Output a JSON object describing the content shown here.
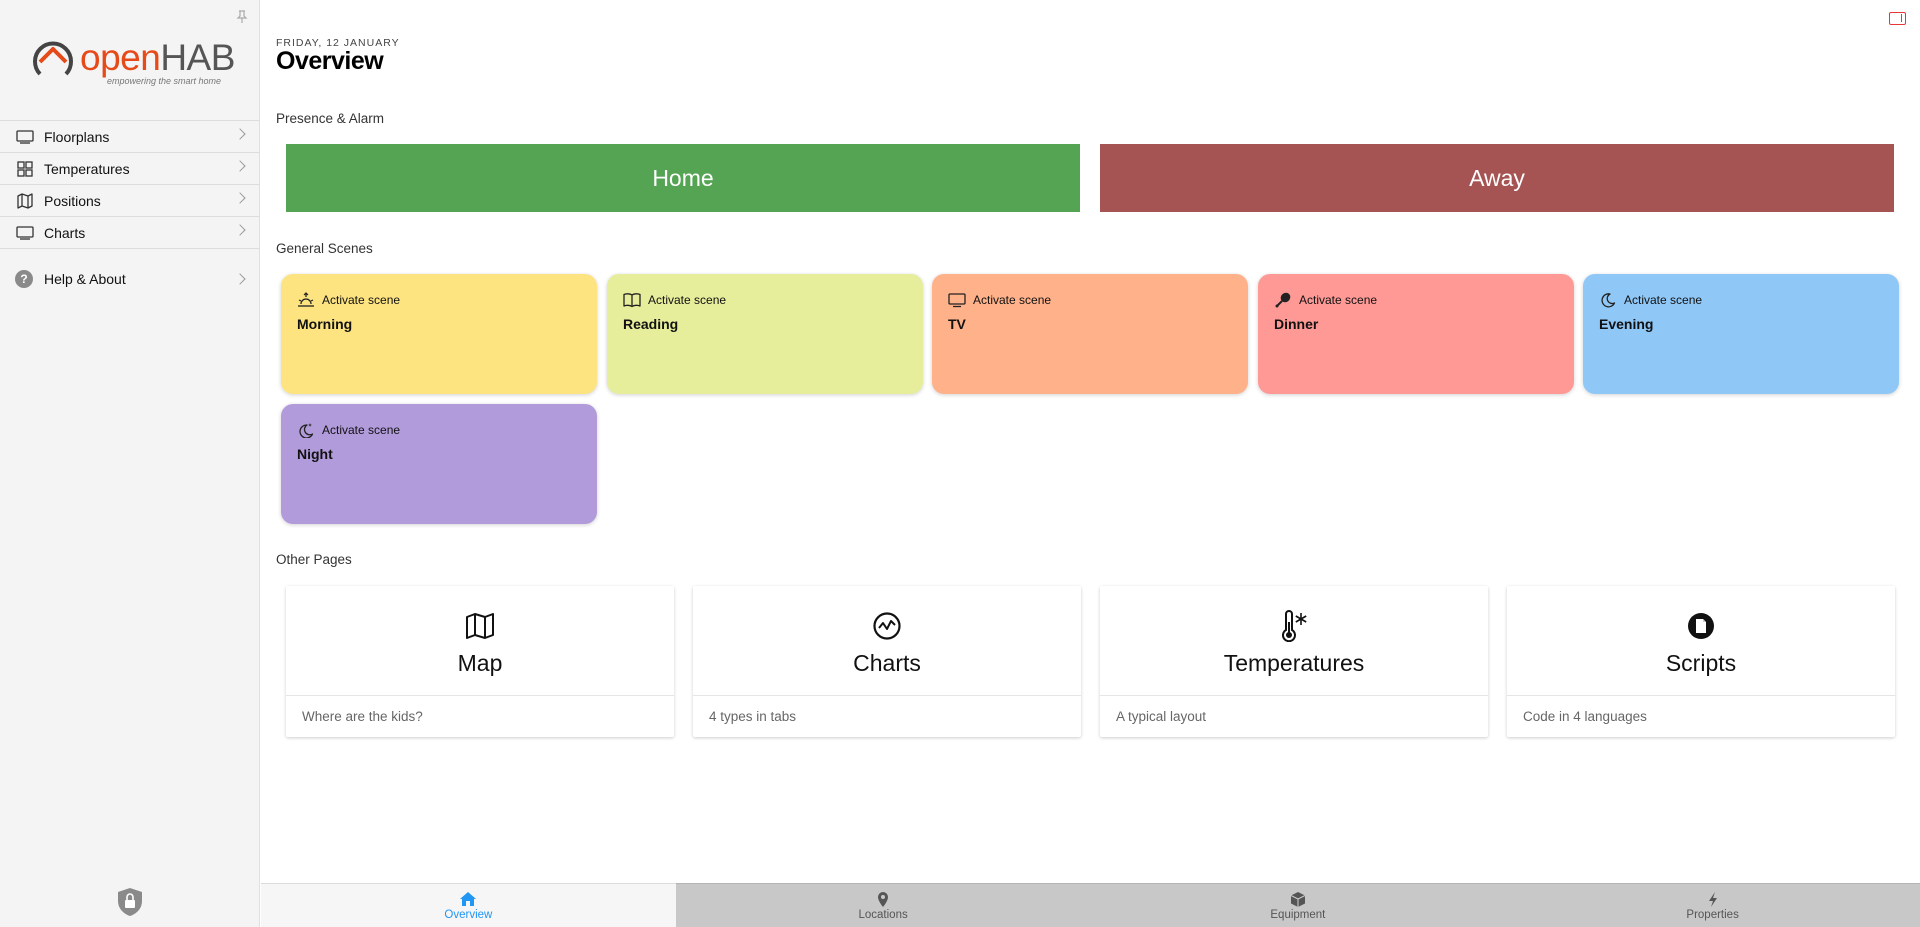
{
  "sidebar": {
    "logo": {
      "word_open": "open",
      "word_hab": "HAB",
      "tagline": "empowering the smart home"
    },
    "items": [
      {
        "label": "Floorplans",
        "icon": "display-icon"
      },
      {
        "label": "Temperatures",
        "icon": "grid-icon"
      },
      {
        "label": "Positions",
        "icon": "map-icon"
      },
      {
        "label": "Charts",
        "icon": "display-icon"
      }
    ],
    "help": {
      "label": "Help & About",
      "icon": "question-icon",
      "icon_glyph": "?"
    }
  },
  "header": {
    "date": "FRIDAY, 12 JANUARY",
    "title": "Overview"
  },
  "presence": {
    "label": "Presence & Alarm",
    "buttons": [
      {
        "label": "Home",
        "color": "#54a454"
      },
      {
        "label": "Away",
        "color": "#a55353"
      }
    ]
  },
  "scenes": {
    "label": "General Scenes",
    "action_label": "Activate scene",
    "items": [
      {
        "name": "Morning",
        "color": "#fde481",
        "icon": "sunrise-icon"
      },
      {
        "name": "Reading",
        "color": "#e6ed9b",
        "icon": "book-icon"
      },
      {
        "name": "TV",
        "color": "#ffb18a",
        "icon": "tv-icon"
      },
      {
        "name": "Dinner",
        "color": "#ff9995",
        "icon": "drumstick-icon"
      },
      {
        "name": "Evening",
        "color": "#8fc8f7",
        "icon": "moon-icon"
      },
      {
        "name": "Night",
        "color": "#b19bdb",
        "icon": "moon-stars-icon"
      }
    ]
  },
  "other_pages": {
    "label": "Other Pages",
    "items": [
      {
        "title": "Map",
        "footer": "Where are the kids?",
        "icon": "map-icon"
      },
      {
        "title": "Charts",
        "footer": "4 types in tabs",
        "icon": "chart-icon"
      },
      {
        "title": "Temperatures",
        "footer": "A typical layout",
        "icon": "thermometer-snow-icon"
      },
      {
        "title": "Scripts",
        "footer": "Code in 4 languages",
        "icon": "document-icon"
      }
    ]
  },
  "tabbar": {
    "tabs": [
      {
        "label": "Overview",
        "icon": "house-icon",
        "active": true
      },
      {
        "label": "Locations",
        "icon": "location-pin-icon",
        "active": false
      },
      {
        "label": "Equipment",
        "icon": "cube-icon",
        "active": false
      },
      {
        "label": "Properties",
        "icon": "bolt-icon",
        "active": false
      }
    ]
  },
  "colors": {
    "accent": "#2196f3",
    "brand_orange": "#e64a19",
    "toggle_red": "#e53935"
  }
}
